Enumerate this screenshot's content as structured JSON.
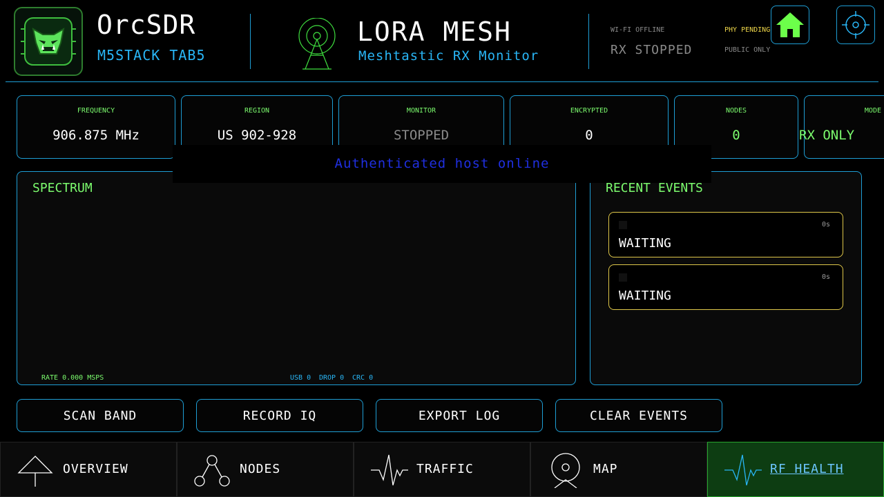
{
  "header": {
    "app_title": "OrcSDR",
    "app_subtitle": "M5STACK TAB5",
    "mode_title": "LORA MESH",
    "mode_subtitle": "Meshtastic RX Monitor",
    "wifi_status": "WI-FI OFFLINE",
    "rx_status": "RX STOPPED",
    "phy_status": "PHY PENDING",
    "access_status": "PUBLIC ONLY"
  },
  "stats": [
    {
      "label": "FREQUENCY",
      "value": "906.875 MHz"
    },
    {
      "label": "REGION",
      "value": "US 902-928"
    },
    {
      "label": "MONITOR",
      "value": "STOPPED"
    },
    {
      "label": "ENCRYPTED",
      "value": "0"
    },
    {
      "label": "NODES",
      "value": "0"
    },
    {
      "label": "MODE",
      "value": "RX ONLY"
    }
  ],
  "toast": {
    "message": "Authenticated host online"
  },
  "spectrum": {
    "title": "SPECTRUM",
    "rate": "RATE 0.000 MSPS",
    "usb": "USB 0",
    "drop": "DROP 0",
    "crc": "CRC 0"
  },
  "events": {
    "title": "RECENT EVENTS",
    "items": [
      {
        "text": "WAITING",
        "age": "0s"
      },
      {
        "text": "WAITING",
        "age": "0s"
      }
    ]
  },
  "actions": [
    "SCAN BAND",
    "RECORD IQ",
    "EXPORT LOG",
    "CLEAR EVENTS"
  ],
  "nav": [
    {
      "label": "OVERVIEW",
      "icon": "triangle-icon"
    },
    {
      "label": "NODES",
      "icon": "network-icon"
    },
    {
      "label": "TRAFFIC",
      "icon": "pulse-icon"
    },
    {
      "label": "MAP",
      "icon": "map-pin-icon"
    },
    {
      "label": "RF HEALTH",
      "icon": "pulse-icon",
      "active": true
    }
  ],
  "colors": {
    "accent": "#1e9fd6",
    "green": "#7CFC6E",
    "warning": "#f0d84a",
    "active_nav_bg": "#0d3d12",
    "toast_text": "#1f2fe0"
  }
}
